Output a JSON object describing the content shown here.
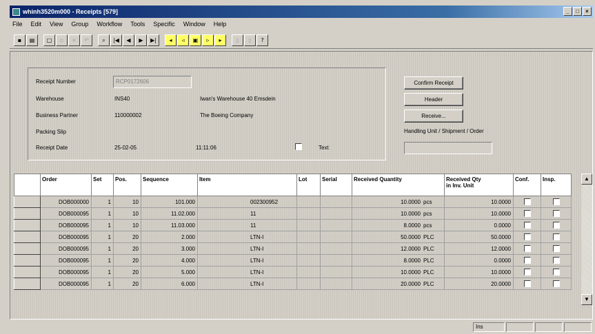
{
  "window": {
    "title": "whinh3520m000 - Receipts [579]"
  },
  "menu": [
    "File",
    "Edit",
    "View",
    "Group",
    "Workflow",
    "Tools",
    "Specific",
    "Window",
    "Help"
  ],
  "toolbar": {
    "nav_first": "|◀",
    "nav_prev": "◀",
    "nav_next": "▶",
    "nav_last": "▶|",
    "help": "?"
  },
  "header": {
    "receipt_number_label": "Receipt Number",
    "receipt_number_value": "RCP0172606",
    "warehouse_label": "Warehouse",
    "warehouse_code": "INS40",
    "warehouse_desc": "Iwan's Warehouse 40 Emsdein",
    "business_partner_label": "Business Partner",
    "business_partner_code": "110000002",
    "business_partner_desc": "The Boeing Company",
    "packing_slip_label": "Packing Slip",
    "receipt_date_label": "Receipt Date",
    "receipt_date_value": "25-02-05",
    "receipt_time_value": "11:11:06",
    "text_label": "Text"
  },
  "buttons": {
    "confirm_receipt": "Confirm Receipt",
    "header": "Header",
    "receive": "Receive...",
    "handling_unit_label": "Handling Unit / Shipment / Order"
  },
  "grid": {
    "columns": [
      "",
      "Order",
      "Set",
      "Pos.",
      "Sequence",
      "Item",
      "Lot",
      "Serial",
      "Received Quantity",
      "Received Qty\nin Inv. Unit",
      "Conf.",
      "Insp."
    ],
    "rows": [
      {
        "order": "DOB000000",
        "set": "1",
        "pos": "10",
        "seq": "101.000",
        "item": "002300952",
        "qty": "10.0000",
        "unit": "pcs",
        "inv_qty": "10.0000"
      },
      {
        "order": "DOB000095",
        "set": "1",
        "pos": "10",
        "seq": "11.02.000",
        "item": "11",
        "qty": "10.0000",
        "unit": "pcs",
        "inv_qty": "10.0000"
      },
      {
        "order": "DOB000095",
        "set": "1",
        "pos": "10",
        "seq": "11.03.000",
        "item": "11",
        "qty": "8.0000",
        "unit": "pcs",
        "inv_qty": "0.0000"
      },
      {
        "order": "DOB000095",
        "set": "1",
        "pos": "20",
        "seq": "2.000",
        "item": "LTN-I",
        "qty": "50.0000",
        "unit": "PLC",
        "inv_qty": "50.0000"
      },
      {
        "order": "DOB000095",
        "set": "1",
        "pos": "20",
        "seq": "3.000",
        "item": "LTN-I",
        "qty": "12.0000",
        "unit": "PLC",
        "inv_qty": "12.0000"
      },
      {
        "order": "DOB000095",
        "set": "1",
        "pos": "20",
        "seq": "4.000",
        "item": "LTN-I",
        "qty": "8.0000",
        "unit": "PLC",
        "inv_qty": "0.0000"
      },
      {
        "order": "DOB000095",
        "set": "1",
        "pos": "20",
        "seq": "5.000",
        "item": "LTN-I",
        "qty": "10.0000",
        "unit": "PLC",
        "inv_qty": "10.0000"
      },
      {
        "order": "DOB000095",
        "set": "1",
        "pos": "20",
        "seq": "6.000",
        "item": "LTN-I",
        "qty": "20.0000",
        "unit": "PLC",
        "inv_qty": "20.0000"
      }
    ]
  },
  "status": {
    "panel1": "Ins"
  }
}
